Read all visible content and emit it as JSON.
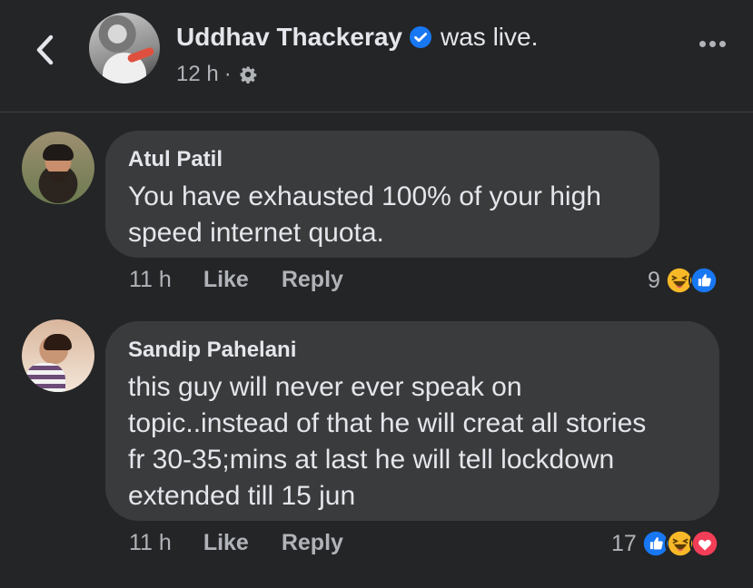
{
  "header": {
    "page_name": "Uddhav Thackeray",
    "status_text": "was live.",
    "time": "12 h",
    "separator": "·"
  },
  "icons": {
    "back": "chevron-left-icon",
    "verified": "verified-badge-icon",
    "privacy": "gear-icon",
    "more": "more-options-icon",
    "like": "like-reaction-icon",
    "haha": "haha-reaction-icon",
    "love": "love-reaction-icon"
  },
  "colors": {
    "background": "#242526",
    "bubble": "#3a3b3c",
    "text": "#e4e6eb",
    "secondary_text": "#b0b3b8",
    "facebook_blue": "#1877f2",
    "haha_yellow": "#f7b928",
    "love_red": "#f33e58"
  },
  "comments": [
    {
      "author": "Atul Patil",
      "text_lines": [
        "You have exhausted 100% of your high",
        "speed internet quota."
      ],
      "time": "11 h",
      "like_label": "Like",
      "reply_label": "Reply",
      "reaction_count": "9",
      "reactions": [
        "haha",
        "like"
      ]
    },
    {
      "author": "Sandip Pahelani",
      "text_lines": [
        "this guy will never ever speak on",
        "topic..instead of that he will creat all stories",
        "fr 30-35;mins at last he will tell lockdown",
        "extended till 15 jun"
      ],
      "time": "11 h",
      "like_label": "Like",
      "reply_label": "Reply",
      "reaction_count": "17",
      "reactions": [
        "like",
        "haha",
        "love"
      ]
    }
  ]
}
